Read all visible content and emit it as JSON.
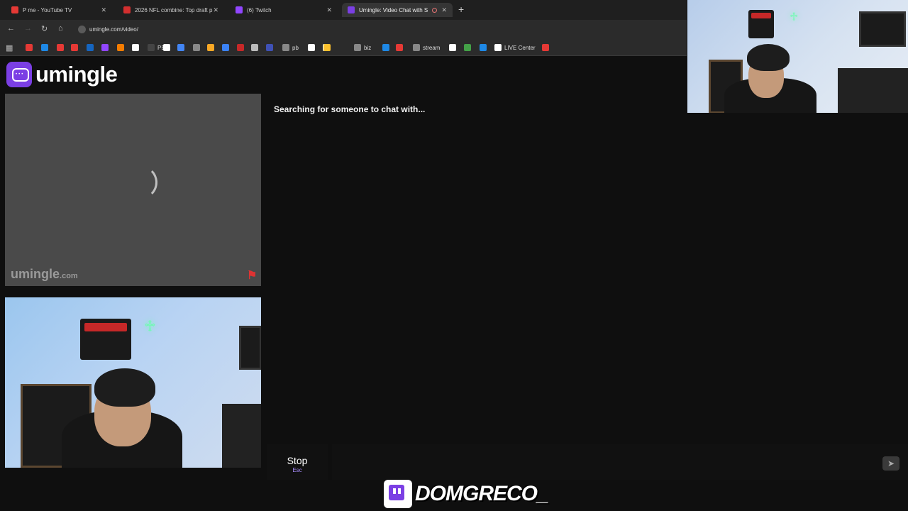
{
  "browser": {
    "tabs": [
      {
        "label": "P   me - YouTube TV",
        "favicon_color": "#e53935"
      },
      {
        "label": "2026 NFL combine: Top draft p",
        "favicon_color": "#d32f2f"
      },
      {
        "label": "(6) Twitch",
        "favicon_color": "#9146ff"
      },
      {
        "label": "Umingle: Video Chat with S",
        "favicon_color": "#7b3fe4",
        "active": true
      }
    ],
    "new_tab_icon": "plus-icon",
    "url": "umingle.com/video/",
    "bookmarks": [
      {
        "label": "",
        "color": "#e53935"
      },
      {
        "label": "",
        "color": "#1e88e5"
      },
      {
        "label": "",
        "color": "#e53935"
      },
      {
        "label": "",
        "color": "#e53935"
      },
      {
        "label": "",
        "color": "#1565c0"
      },
      {
        "label": "",
        "color": "#9146ff"
      },
      {
        "label": "",
        "color": "#f57c00"
      },
      {
        "label": "",
        "color": "#ffffff"
      },
      {
        "label": "PB",
        "color": "#444444"
      },
      {
        "label": "",
        "color": "#ffffff"
      },
      {
        "label": "",
        "color": "#4285f4"
      },
      {
        "label": "",
        "color": "#888888"
      },
      {
        "label": "",
        "color": "#f9a825"
      },
      {
        "label": "",
        "color": "#3b82f6"
      },
      {
        "label": "",
        "color": "#c62828"
      },
      {
        "label": "",
        "color": "#bbbbbb"
      },
      {
        "label": "",
        "color": "#3f51b5"
      },
      {
        "label": "pb",
        "color": "#888888"
      },
      {
        "label": "",
        "color": "#ffffff"
      },
      {
        "label": "",
        "color": "#ffffff"
      },
      {
        "label": "",
        "color": "#fbc02d"
      },
      {
        "label": "biz",
        "color": "#888888"
      },
      {
        "label": "",
        "color": "#1e88e5"
      },
      {
        "label": "",
        "color": "#e53935"
      },
      {
        "label": "stream",
        "color": "#888888"
      },
      {
        "label": "",
        "color": "#ffffff"
      },
      {
        "label": "",
        "color": "#43a047"
      },
      {
        "label": "",
        "color": "#1e88e5"
      },
      {
        "label": "LIVE Center",
        "color": "#ffffff"
      },
      {
        "label": "",
        "color": "#e53935"
      }
    ]
  },
  "site": {
    "logo_text": "umingle",
    "brand_color": "#7b3fe4",
    "stranger_video": {
      "watermark": "umingle",
      "watermark_suffix": ".com"
    },
    "status_text": "Searching for someone to chat with...",
    "stop_button": {
      "label": "Stop",
      "shortcut": "Esc"
    },
    "message_input": {
      "placeholder": "",
      "value": ""
    },
    "send_icon": "send-icon"
  },
  "stream_overlay": {
    "streamer_name": "DOMGRECO_",
    "platform_icon": "twitch-icon"
  }
}
